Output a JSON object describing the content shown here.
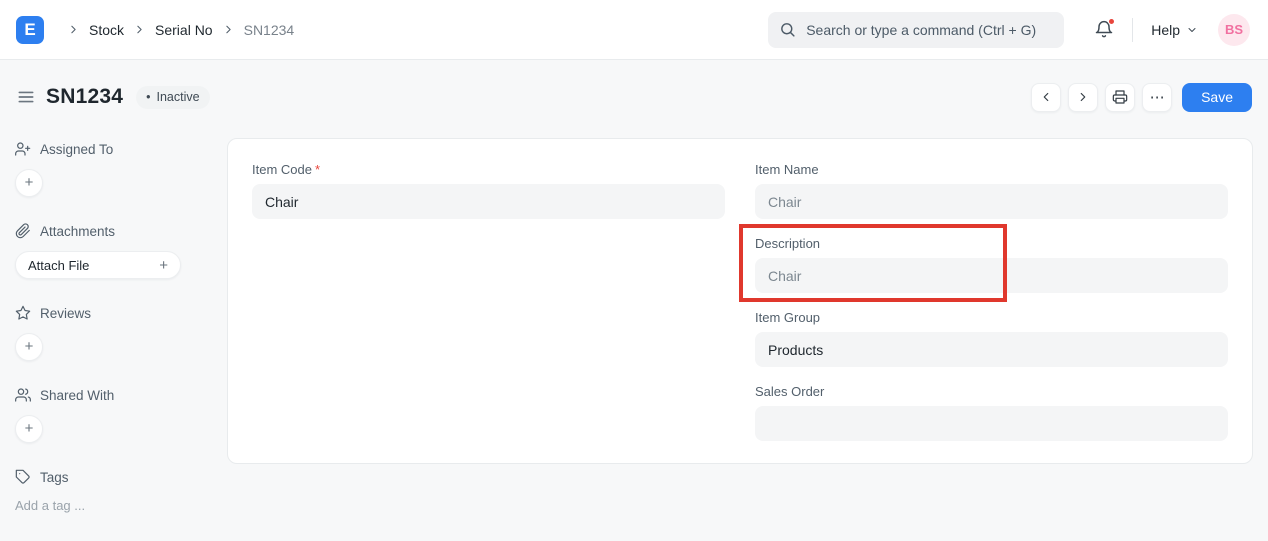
{
  "navbar": {
    "logo_letter": "E",
    "breadcrumb": [
      "Stock",
      "Serial No",
      "SN1234"
    ],
    "search_placeholder": "Search or type a command (Ctrl + G)",
    "help_label": "Help",
    "avatar_initials": "BS"
  },
  "page_head": {
    "title": "SN1234",
    "status_dot": "•",
    "status": "Inactive",
    "ellipsis_glyph": "⋯",
    "save_label": "Save"
  },
  "sidebar": {
    "assigned_to_label": "Assigned To",
    "attachments_label": "Attachments",
    "attach_file_label": "Attach File",
    "reviews_label": "Reviews",
    "shared_with_label": "Shared With",
    "tags_label": "Tags",
    "add_tag_placeholder": "Add a tag ...",
    "plus_glyph": "+"
  },
  "form": {
    "item_code": {
      "label": "Item Code",
      "required_marker": "*",
      "value": "Chair"
    },
    "item_name": {
      "label": "Item Name",
      "value": "Chair"
    },
    "description": {
      "label": "Description",
      "value": "Chair"
    },
    "item_group": {
      "label": "Item Group",
      "value": "Products"
    },
    "sales_order": {
      "label": "Sales Order",
      "value": ""
    }
  },
  "colors": {
    "accent_blue": "#2d7ff0",
    "annotation_red": "#e0382d",
    "notification_dot_red": "#e8453c",
    "avatar_bg_pink": "#fde8ee",
    "avatar_text_pink": "#f170a0",
    "badge_gray_bg": "#f1f3f4",
    "input_gray_bg": "#f4f5f6"
  }
}
